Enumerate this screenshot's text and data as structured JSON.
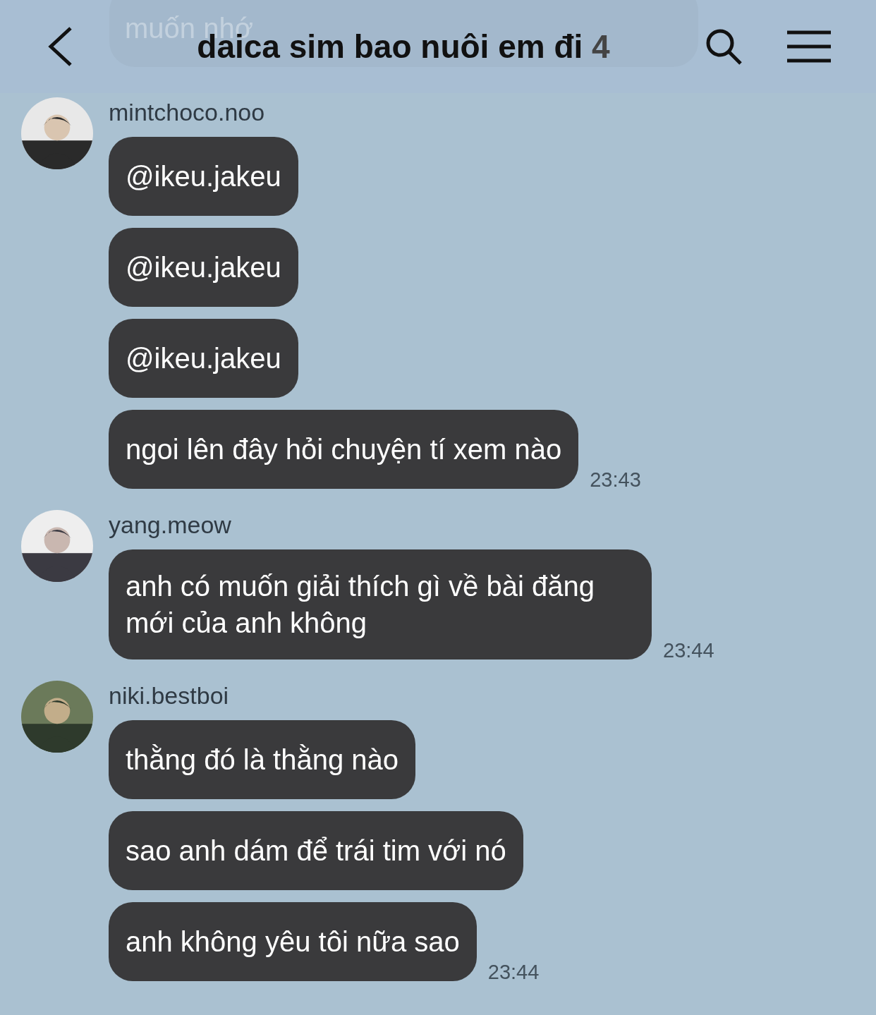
{
  "header": {
    "title": "daica sim bao nuôi em đi",
    "member_count": "4",
    "behind_message": "muốn nhớ"
  },
  "groups": [
    {
      "sender": "mintchoco.noo",
      "avatar": {
        "kind": "picture"
      },
      "messages": [
        "@ikeu.jakeu",
        "@ikeu.jakeu",
        "@ikeu.jakeu",
        "ngoi lên đây hỏi chuyện tí xem nào"
      ],
      "time": "23:43"
    },
    {
      "sender": "yang.meow",
      "avatar": {
        "kind": "picture"
      },
      "messages": [
        "anh có muốn giải thích gì về bài đăng mới của anh không"
      ],
      "time": "23:44"
    },
    {
      "sender": "niki.bestboi",
      "avatar": {
        "kind": "picture"
      },
      "messages": [
        "thằng đó là thằng nào",
        "sao anh dám để trái tim với nó",
        "anh không yêu tôi nữa sao"
      ],
      "time": "23:44"
    }
  ]
}
